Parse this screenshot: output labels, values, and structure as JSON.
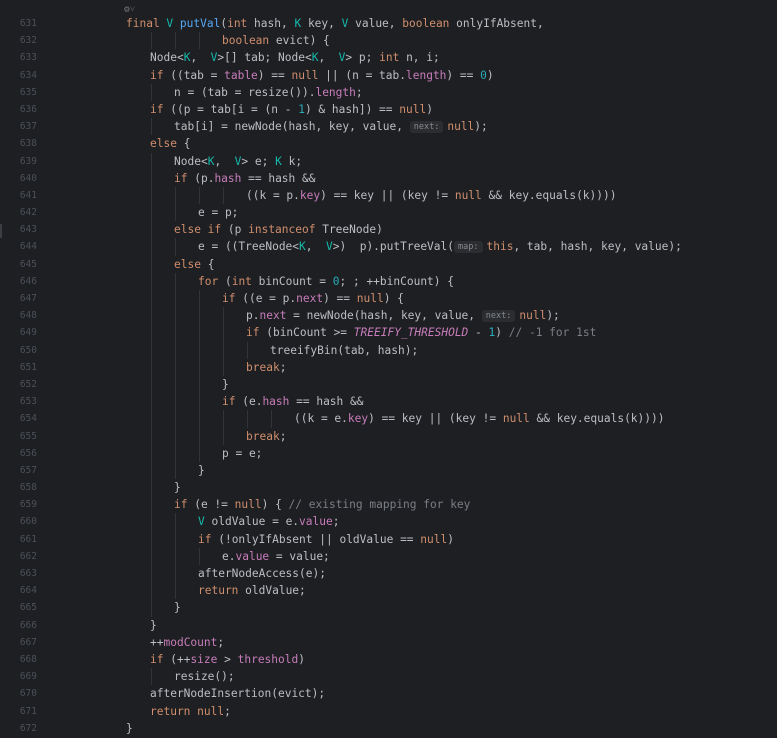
{
  "editor": {
    "header_hint": "⚙︎˅",
    "lines": [
      {
        "no": "631",
        "indent": 0,
        "tokens": [
          [
            "kw",
            "final "
          ],
          [
            "tp",
            "V "
          ],
          [
            "fn",
            "putVal"
          ],
          [
            "",
            "("
          ],
          [
            "kw",
            "int "
          ],
          [
            "",
            "hash, "
          ],
          [
            "tp",
            "K "
          ],
          [
            "",
            "key, "
          ],
          [
            "tp",
            "V "
          ],
          [
            "",
            "value, "
          ],
          [
            "kw",
            "boolean "
          ],
          [
            "",
            "onlyIfAbsent,"
          ]
        ]
      },
      {
        "no": "632",
        "indent": 4,
        "tokens": [
          [
            "kw",
            "boolean "
          ],
          [
            "",
            "evict) {"
          ]
        ]
      },
      {
        "no": "633",
        "indent": 1,
        "tokens": [
          [
            "",
            "Node<"
          ],
          [
            "tp",
            "K"
          ],
          [
            "",
            ",  "
          ],
          [
            "tp",
            "V"
          ],
          [
            "",
            ">[] tab; Node<"
          ],
          [
            "tp",
            "K"
          ],
          [
            "",
            ",  "
          ],
          [
            "tp",
            "V"
          ],
          [
            "",
            "> p; "
          ],
          [
            "kw",
            "int "
          ],
          [
            "",
            "n, i;"
          ]
        ]
      },
      {
        "no": "634",
        "indent": 1,
        "tokens": [
          [
            "kw",
            "if "
          ],
          [
            "",
            "((tab = "
          ],
          [
            "fld",
            "table"
          ],
          [
            "",
            ") == "
          ],
          [
            "kw",
            "null "
          ],
          [
            "",
            "|| (n = tab."
          ],
          [
            "fld",
            "length"
          ],
          [
            "",
            ") == "
          ],
          [
            "num",
            "0"
          ],
          [
            "",
            ")"
          ]
        ]
      },
      {
        "no": "635",
        "indent": 2,
        "tokens": [
          [
            "",
            "n = (tab = resize())."
          ],
          [
            "fld",
            "length"
          ],
          [
            "",
            ";"
          ]
        ]
      },
      {
        "no": "636",
        "indent": 1,
        "tokens": [
          [
            "kw",
            "if "
          ],
          [
            "",
            "((p = tab[i = (n - "
          ],
          [
            "num",
            "1"
          ],
          [
            "",
            ") & hash]) == "
          ],
          [
            "kw",
            "null"
          ],
          [
            "",
            ")"
          ]
        ]
      },
      {
        "no": "637",
        "indent": 2,
        "tokens": [
          [
            "",
            "tab[i] = newNode(hash, key, value, "
          ],
          [
            "hint",
            "next:"
          ],
          [
            "kw",
            "null"
          ],
          [
            "",
            ");"
          ]
        ]
      },
      {
        "no": "638",
        "indent": 1,
        "tokens": [
          [
            "kw",
            "else "
          ],
          [
            "",
            "{"
          ]
        ]
      },
      {
        "no": "639",
        "indent": 2,
        "tokens": [
          [
            "",
            "Node<"
          ],
          [
            "tp",
            "K"
          ],
          [
            "",
            ",  "
          ],
          [
            "tp",
            "V"
          ],
          [
            "",
            "> e; "
          ],
          [
            "tp",
            "K "
          ],
          [
            "",
            "k;"
          ]
        ]
      },
      {
        "no": "640",
        "indent": 2,
        "tokens": [
          [
            "kw",
            "if "
          ],
          [
            "",
            "(p."
          ],
          [
            "fld",
            "hash "
          ],
          [
            "",
            "== hash &&"
          ]
        ]
      },
      {
        "no": "641",
        "indent": 5,
        "tokens": [
          [
            "",
            "((k = p."
          ],
          [
            "fld",
            "key"
          ],
          [
            "",
            ") == key || (key != "
          ],
          [
            "kw",
            "null "
          ],
          [
            "",
            "&& key.equals(k))))"
          ]
        ]
      },
      {
        "no": "642",
        "indent": 3,
        "tokens": [
          [
            "",
            "e = p;"
          ]
        ]
      },
      {
        "no": "643",
        "indent": 2,
        "tokens": [
          [
            "kw",
            "else if "
          ],
          [
            "",
            "(p "
          ],
          [
            "kw",
            "instanceof "
          ],
          [
            "",
            "TreeNode)"
          ]
        ]
      },
      {
        "no": "644",
        "indent": 3,
        "tokens": [
          [
            "",
            "e = ((TreeNode<"
          ],
          [
            "tp",
            "K"
          ],
          [
            "",
            ",  "
          ],
          [
            "tp",
            "V"
          ],
          [
            "",
            ">)  p).putTreeVal("
          ],
          [
            "hint",
            "map:"
          ],
          [
            "kw",
            "this"
          ],
          [
            "",
            ", tab, hash, key, value);"
          ]
        ]
      },
      {
        "no": "645",
        "indent": 2,
        "tokens": [
          [
            "kw",
            "else "
          ],
          [
            "",
            "{"
          ]
        ]
      },
      {
        "no": "646",
        "indent": 3,
        "tokens": [
          [
            "kw",
            "for "
          ],
          [
            "",
            "("
          ],
          [
            "kw",
            "int "
          ],
          [
            "",
            "binCount = "
          ],
          [
            "num",
            "0"
          ],
          [
            "",
            "; ; ++binCount) {"
          ]
        ]
      },
      {
        "no": "647",
        "indent": 4,
        "tokens": [
          [
            "kw",
            "if "
          ],
          [
            "",
            "((e = p."
          ],
          [
            "fld",
            "next"
          ],
          [
            "",
            ") == "
          ],
          [
            "kw",
            "null"
          ],
          [
            "",
            ") {"
          ]
        ]
      },
      {
        "no": "648",
        "indent": 5,
        "tokens": [
          [
            "",
            "p."
          ],
          [
            "fld",
            "next "
          ],
          [
            "",
            "= newNode(hash, key, value, "
          ],
          [
            "hint",
            "next:"
          ],
          [
            "kw",
            "null"
          ],
          [
            "",
            ");"
          ]
        ]
      },
      {
        "no": "649",
        "indent": 5,
        "tokens": [
          [
            "kw",
            "if "
          ],
          [
            "",
            "(binCount >= "
          ],
          [
            "cst",
            "TREEIFY_THRESHOLD "
          ],
          [
            "",
            "- "
          ],
          [
            "num",
            "1"
          ],
          [
            "",
            ") "
          ],
          [
            "cmt",
            "// -1 for 1st"
          ]
        ]
      },
      {
        "no": "650",
        "indent": 6,
        "tokens": [
          [
            "",
            "treeifyBin(tab, hash);"
          ]
        ]
      },
      {
        "no": "651",
        "indent": 5,
        "tokens": [
          [
            "kw",
            "break"
          ],
          [
            "",
            ";"
          ]
        ]
      },
      {
        "no": "652",
        "indent": 4,
        "tokens": [
          [
            "",
            "}"
          ]
        ]
      },
      {
        "no": "653",
        "indent": 4,
        "tokens": [
          [
            "kw",
            "if "
          ],
          [
            "",
            "(e."
          ],
          [
            "fld",
            "hash "
          ],
          [
            "",
            "== hash &&"
          ]
        ]
      },
      {
        "no": "654",
        "indent": 7,
        "tokens": [
          [
            "",
            "((k = e."
          ],
          [
            "fld",
            "key"
          ],
          [
            "",
            ") == key || (key != "
          ],
          [
            "kw",
            "null "
          ],
          [
            "",
            "&& key.equals(k))))"
          ]
        ]
      },
      {
        "no": "655",
        "indent": 5,
        "tokens": [
          [
            "kw",
            "break"
          ],
          [
            "",
            ";"
          ]
        ]
      },
      {
        "no": "656",
        "indent": 4,
        "tokens": [
          [
            "",
            "p = e;"
          ]
        ]
      },
      {
        "no": "657",
        "indent": 3,
        "tokens": [
          [
            "",
            "}"
          ]
        ]
      },
      {
        "no": "658",
        "indent": 2,
        "tokens": [
          [
            "",
            "}"
          ]
        ]
      },
      {
        "no": "659",
        "indent": 2,
        "tokens": [
          [
            "kw",
            "if "
          ],
          [
            "",
            "(e != "
          ],
          [
            "kw",
            "null"
          ],
          [
            "",
            ") { "
          ],
          [
            "cmt",
            "// existing mapping for key"
          ]
        ]
      },
      {
        "no": "660",
        "indent": 3,
        "tokens": [
          [
            "tp",
            "V "
          ],
          [
            "",
            "oldValue = e."
          ],
          [
            "fld",
            "value"
          ],
          [
            "",
            ";"
          ]
        ]
      },
      {
        "no": "661",
        "indent": 3,
        "tokens": [
          [
            "kw",
            "if "
          ],
          [
            "",
            "(!onlyIfAbsent || oldValue == "
          ],
          [
            "kw",
            "null"
          ],
          [
            "",
            ")"
          ]
        ]
      },
      {
        "no": "662",
        "indent": 4,
        "tokens": [
          [
            "",
            "e."
          ],
          [
            "fld",
            "value "
          ],
          [
            "",
            "= value;"
          ]
        ]
      },
      {
        "no": "663",
        "indent": 3,
        "tokens": [
          [
            "",
            "afterNodeAccess(e);"
          ]
        ]
      },
      {
        "no": "664",
        "indent": 3,
        "tokens": [
          [
            "kw",
            "return "
          ],
          [
            "",
            "oldValue;"
          ]
        ]
      },
      {
        "no": "665",
        "indent": 2,
        "tokens": [
          [
            "",
            "}"
          ]
        ]
      },
      {
        "no": "666",
        "indent": 1,
        "tokens": [
          [
            "",
            "}"
          ]
        ]
      },
      {
        "no": "667",
        "indent": 1,
        "tokens": [
          [
            "",
            "++"
          ],
          [
            "fld",
            "modCount"
          ],
          [
            "",
            ";"
          ]
        ]
      },
      {
        "no": "668",
        "indent": 1,
        "tokens": [
          [
            "kw",
            "if "
          ],
          [
            "",
            "(++"
          ],
          [
            "fld",
            "size "
          ],
          [
            "",
            "> "
          ],
          [
            "fld",
            "threshold"
          ],
          [
            "",
            ")"
          ]
        ]
      },
      {
        "no": "669",
        "indent": 2,
        "tokens": [
          [
            "",
            "resize();"
          ]
        ]
      },
      {
        "no": "670",
        "indent": 1,
        "tokens": [
          [
            "",
            "afterNodeInsertion(evict);"
          ]
        ]
      },
      {
        "no": "671",
        "indent": 1,
        "tokens": [
          [
            "kw",
            "return "
          ],
          [
            "kw",
            "null"
          ],
          [
            "",
            ";"
          ]
        ]
      },
      {
        "no": "672",
        "indent": 0,
        "tokens": [
          [
            "",
            "}"
          ]
        ]
      }
    ]
  }
}
